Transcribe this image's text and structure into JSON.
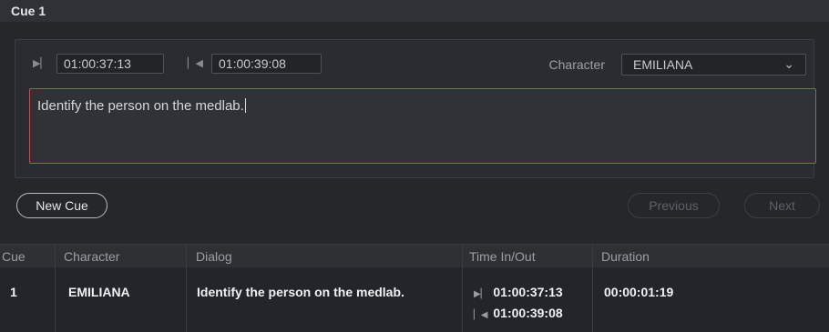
{
  "title": "Cue 1",
  "editor": {
    "time_in": "01:00:37:13",
    "time_out": "01:00:39:08",
    "character_label": "Character",
    "character_value": "EMILIANA",
    "dialog_text": "Identify the person on the medlab."
  },
  "buttons": {
    "new_cue": "New Cue",
    "previous": "Previous",
    "next": "Next"
  },
  "table": {
    "headers": [
      "Cue",
      "Character",
      "Dialog",
      "Time In/Out",
      "Duration"
    ],
    "rows": [
      {
        "cue": "1",
        "character": "EMILIANA",
        "dialog": "Identify the person on the medlab.",
        "time_in": "01:00:37:13",
        "time_out": "01:00:39:08",
        "duration": "00:00:01:19"
      }
    ]
  },
  "icons": {
    "time_in": "mark-in-icon",
    "time_out": "mark-out-icon",
    "dropdown": "chevron-down-icon"
  },
  "colors": {
    "dialog_border": "#b8544e",
    "background": "#26272b"
  }
}
